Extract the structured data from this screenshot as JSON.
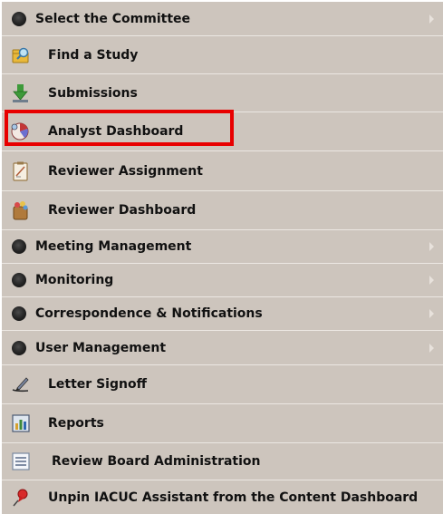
{
  "menu": {
    "items": [
      {
        "label": "Select the Committee",
        "icon": "bullet-icon",
        "has_submenu": true
      },
      {
        "label": "Find a Study",
        "icon": "find-study-icon",
        "has_submenu": false
      },
      {
        "label": "Submissions",
        "icon": "submissions-icon",
        "has_submenu": false
      },
      {
        "label": "Analyst Dashboard",
        "icon": "analyst-dashboard-icon",
        "has_submenu": false,
        "highlighted": true
      },
      {
        "label": "Reviewer Assignment",
        "icon": "reviewer-assignment-icon",
        "has_submenu": false
      },
      {
        "label": "Reviewer Dashboard",
        "icon": "reviewer-dashboard-icon",
        "has_submenu": false
      },
      {
        "label": "Meeting Management",
        "icon": "bullet-icon",
        "has_submenu": true
      },
      {
        "label": "Monitoring",
        "icon": "bullet-icon",
        "has_submenu": true
      },
      {
        "label": "Correspondence & Notifications",
        "icon": "bullet-icon",
        "has_submenu": true
      },
      {
        "label": "User Management",
        "icon": "bullet-icon",
        "has_submenu": true
      },
      {
        "label": "Letter Signoff",
        "icon": "letter-signoff-icon",
        "has_submenu": false
      },
      {
        "label": "Reports",
        "icon": "reports-icon",
        "has_submenu": false
      },
      {
        "label": "Review Board Administration",
        "icon": "review-board-icon",
        "has_submenu": false
      },
      {
        "label": "Unpin IACUC Assistant from the Content Dashboard",
        "icon": "pushpin-icon",
        "has_submenu": false
      }
    ],
    "highlight_color": "#e80000",
    "background_color": "#cdc5bd"
  }
}
